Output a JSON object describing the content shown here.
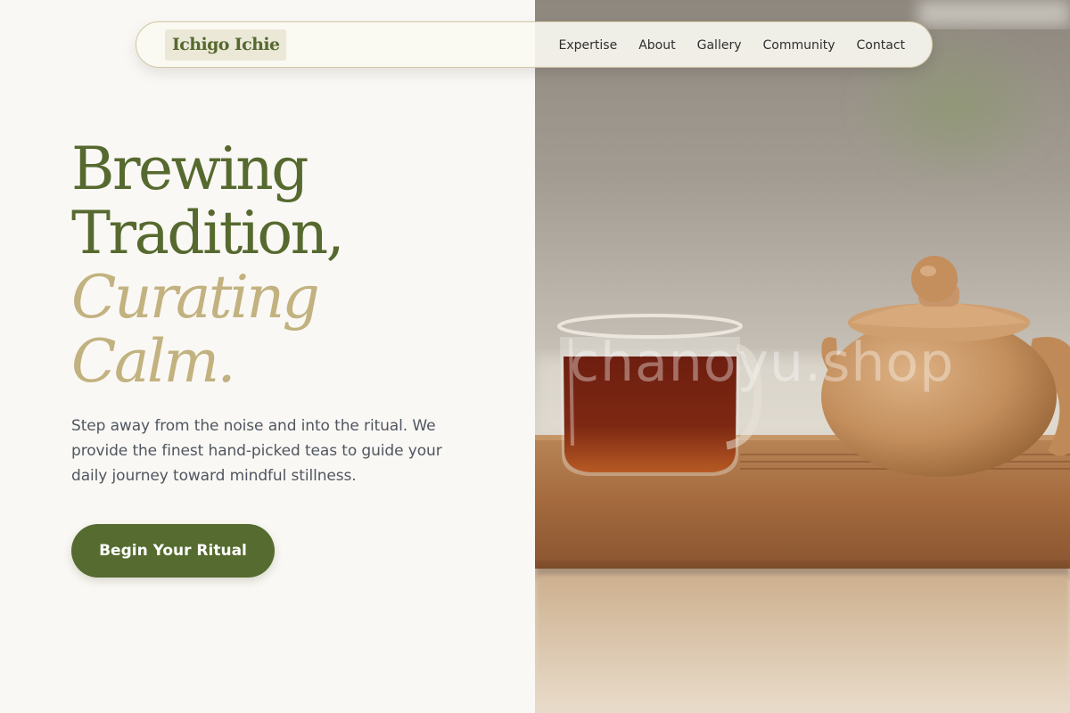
{
  "brand": {
    "name": "Ichigo Ichie"
  },
  "nav": {
    "links": [
      "Expertise",
      "About",
      "Gallery",
      "Community",
      "Contact"
    ]
  },
  "hero": {
    "title_line1": "Brewing",
    "title_line2": "Tradition,",
    "title_line3": "Curating",
    "title_line4": "Calm.",
    "description": "Step away from the noise and into the ritual. We provide the finest hand-picked teas to guide your daily journey toward mindful stillness.",
    "cta_label": "Begin Your Ritual"
  },
  "image": {
    "watermark": "chanoyu.shop"
  },
  "colors": {
    "accent_green": "#556b2f",
    "accent_gold": "#c2b280",
    "background": "#faf8f4"
  }
}
